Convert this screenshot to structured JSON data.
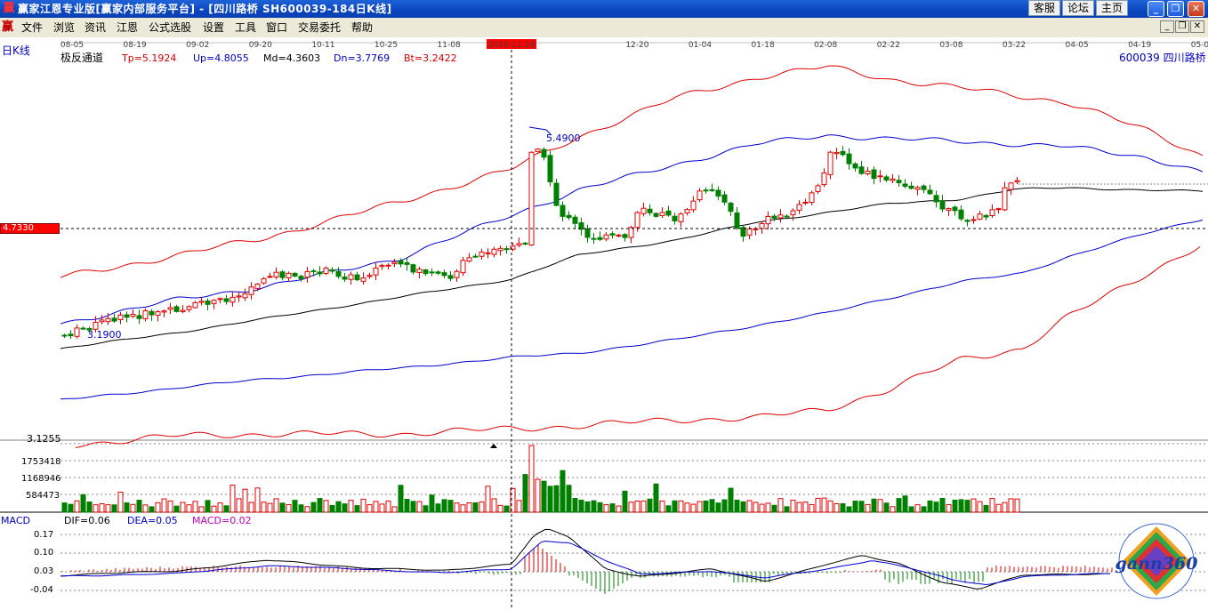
{
  "window": {
    "title": "赢家江恩专业版[赢家内部服务平台] - [四川路桥   SH600039-184日K线]",
    "app_icon": "赢",
    "buttons": [
      "客服",
      "论坛",
      "主页"
    ],
    "minimize": "_",
    "restore": "❐",
    "close": "✕"
  },
  "menu": {
    "icon": "赢",
    "items": [
      "文件",
      "浏览",
      "资讯",
      "江恩",
      "公式选股",
      "设置",
      "工具",
      "窗口",
      "交易委托",
      "帮助"
    ],
    "mdi_min": "_",
    "mdi_restore": "❐",
    "mdi_close": "✕"
  },
  "chart": {
    "period_label": "日K线",
    "indicator_name": "极反通道",
    "tp": "Tp=5.1924",
    "up": "Up=4.8055",
    "md": "Md=4.3603",
    "dn": "Dn=3.7769",
    "bt": "Bt=3.2422",
    "stock": "600039 四川路桥",
    "date_ticks": [
      "08-05",
      "08-19",
      "09-02",
      "09-20",
      "10-11",
      "10-25",
      "11-08",
      "2016-11-24",
      "12-06",
      "12-20",
      "01-04",
      "01-18",
      "02-08",
      "02-22",
      "03-08",
      "03-22",
      "04-05",
      "04-19",
      "05-03"
    ],
    "crosshair_price": "4.7330",
    "high_label": "5.4900",
    "low_label": "3.1900",
    "bottom_price": "3.1255",
    "volume_ticks": [
      "1753418",
      "1168946",
      "584473"
    ],
    "macd_title": "MACD",
    "dif": "DIF=0.06",
    "dea": "DEA=0.05",
    "macd": "MACD=0.02",
    "macd_ticks": [
      "0.17",
      "0.10",
      "0.03",
      "-0.04"
    ],
    "watermark": "gann360",
    "colors": {
      "up_candle": "#e00000",
      "down_candle": "#008000",
      "channel_outer": "#e00000",
      "channel_inner": "#0000d0",
      "channel_mid": "#000000",
      "dea_line": "#0000d0",
      "macd_label": "#c000c0",
      "crosshair_box": "#ff0000"
    }
  }
}
